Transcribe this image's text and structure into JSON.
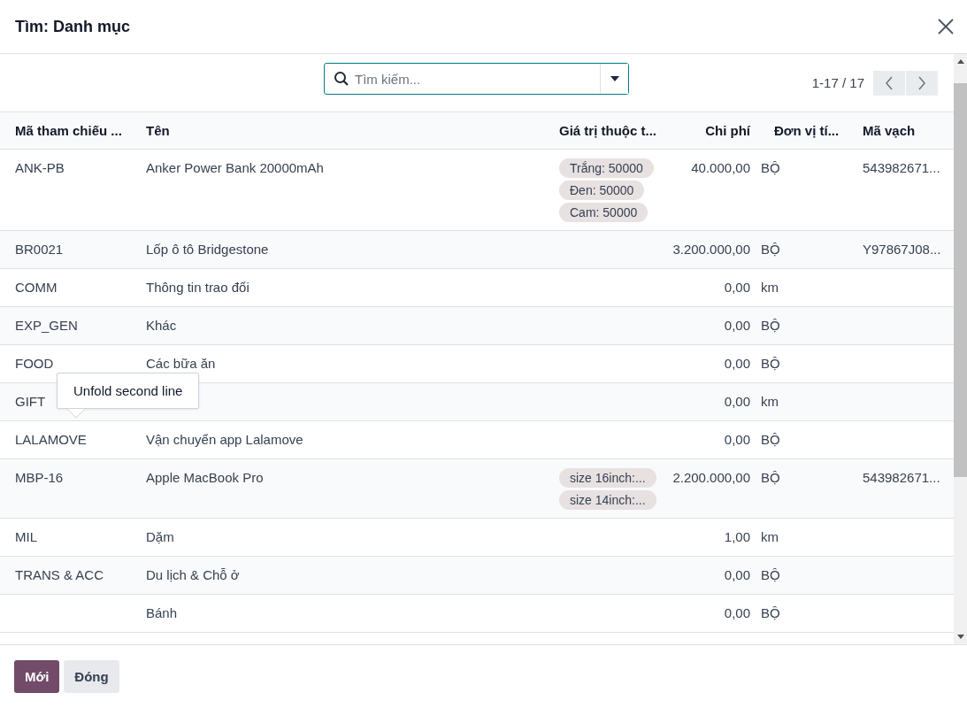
{
  "dialog": {
    "title": "Tìm: Danh mục"
  },
  "search": {
    "placeholder": "Tìm kiếm..."
  },
  "pager": {
    "range": "1-17 / 17"
  },
  "table": {
    "columns": [
      "Mã tham chiếu ...",
      "Tên",
      "Giá trị thuộc t...",
      "Chi phí",
      "Đơn vị tí...",
      "Mã vạch"
    ],
    "rows": [
      {
        "ref": "ANK-PB",
        "name": "Anker Power Bank 20000mAh",
        "tags": [
          "Trắng: 50000",
          "Đen: 50000",
          "Cam: 50000"
        ],
        "cost": "40.000,00",
        "unit": "BỘ",
        "barcode": "543982671..."
      },
      {
        "ref": "BR0021",
        "name": "Lốp ô tô Bridgestone",
        "cost": "3.200.000,00",
        "unit": "BỘ",
        "barcode": "Y97867J08..."
      },
      {
        "ref": "COMM",
        "name": "Thông tin trao đổi",
        "cost": "0,00",
        "unit": "km"
      },
      {
        "ref": "EXP_GEN",
        "name": "Khác",
        "cost": "0,00",
        "unit": "BỘ"
      },
      {
        "ref": "FOOD",
        "name": "Các bữa ăn",
        "cost": "0,00",
        "unit": "BỘ"
      },
      {
        "ref": "GIFT",
        "cost": "0,00",
        "unit": "km"
      },
      {
        "ref": "LALAMOVE",
        "name": "Vận chuyển app Lalamove",
        "cost": "0,00",
        "unit": "BỘ"
      },
      {
        "ref": "MBP-16",
        "name": "Apple MacBook Pro",
        "tags": [
          "size 16inch:...",
          "size 14inch:..."
        ],
        "cost": "2.200.000,00",
        "unit": "BỘ",
        "barcode": "543982671..."
      },
      {
        "ref": "MIL",
        "name": "Dặm",
        "cost": "1,00",
        "unit": "km"
      },
      {
        "ref": "TRANS & ACC",
        "name": "Du lịch & Chỗ ở",
        "cost": "0,00",
        "unit": "BỘ"
      },
      {
        "name": "Bánh",
        "cost": "0,00",
        "unit": "BỘ"
      }
    ]
  },
  "tooltip": {
    "text": "Unfold second line"
  },
  "buttons": [
    {
      "label": "Mới",
      "kind": "primary"
    },
    {
      "label": "Đóng",
      "kind": "secondary"
    }
  ]
}
